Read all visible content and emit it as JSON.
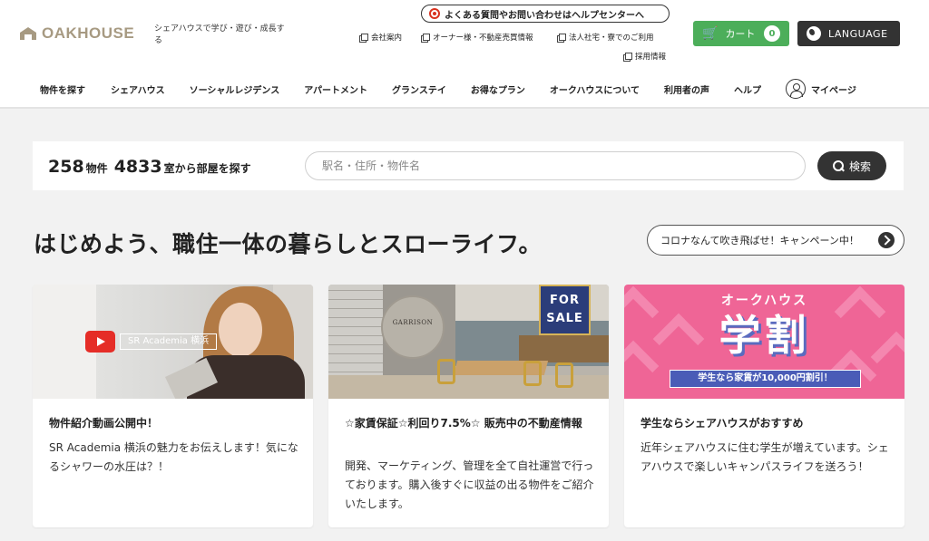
{
  "header": {
    "logo_text": "OAKHOUSE",
    "tagline": "シェアハウスで学び・遊び・成長する",
    "help_center": "よくある質問やお問い合わせはヘルプセンターへ",
    "util_links": [
      "会社案内",
      "オーナー様・不動産売買情報",
      "法人社宅・寮でのご利用",
      "採用情報"
    ],
    "cart_label": "カート",
    "cart_count": "0",
    "language_label": "LANGUAGE"
  },
  "nav": {
    "items": [
      "物件を探す",
      "シェアハウス",
      "ソーシャルレジデンス",
      "アパートメント",
      "グランステイ",
      "お得なプラン",
      "オークハウスについて",
      "利用者の声",
      "ヘルプ"
    ],
    "mypage": "マイページ"
  },
  "search": {
    "property_count": "258",
    "property_unit": "物件",
    "room_count": "4833",
    "room_unit": "室から部屋を探す",
    "placeholder": "駅名・住所・物件名",
    "button_label": "検索"
  },
  "headline": "はじめよう、職住一体の暮らしとスローライフ。",
  "campaign_button": "コロナなんて吹き飛ばせ！キャンペーン中！",
  "cards": [
    {
      "image_overlay": "SR Academia 横浜",
      "title": "物件紹介動画公開中！",
      "description": "SR Academia 横浜の魅力をお伝えします！気になるシャワーの水圧は？！"
    },
    {
      "image_overlay": "FOR SALE",
      "image_logo": "GARRISON",
      "title": "☆家賃保証☆利回り7.5%☆ 販売中の不動産情報",
      "description": "開発、マーケティング、管理を全て自社運営で行っております。購入後すぐに収益の出る物件をご紹介いたします。"
    },
    {
      "image_overlay_top": "オークハウス",
      "image_overlay_big": "学割",
      "image_overlay_bar": "学生なら家賃が10,000円割引！",
      "title": "学生ならシェアハウスがおすすめ",
      "description": "近年シェアハウスに住む学生が増えています。シェアハウスで楽しいキャンパスライフを送ろう！"
    }
  ],
  "colors": {
    "cart_green": "#4cae5a",
    "dark_button": "#333333",
    "logo_beige": "#a79a82",
    "promo_pink": "#ef6596",
    "help_red": "#d9321f"
  }
}
